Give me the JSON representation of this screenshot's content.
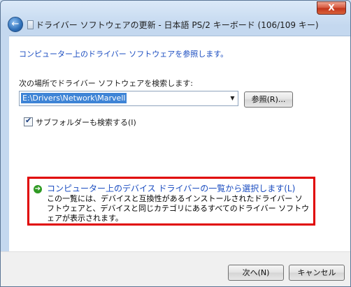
{
  "window": {
    "title": "ドライバー ソフトウェアの更新 - 日本語 PS/2 キーボード (106/109 キー)",
    "close_glyph": "X",
    "back_glyph": "←"
  },
  "main": {
    "heading": "コンピューター上のドライバー ソフトウェアを参照します。",
    "search_label": "次の場所でドライバー ソフトウェアを検索します:",
    "path_value": "E:\\Drivers\\Network\\Marvell",
    "dropdown_arrow": "▼",
    "browse_label": "参照(R)...",
    "subfolder_label": "サブフォルダーも検索する(I)",
    "subfolder_checked": true,
    "option": {
      "title": "コンピューター上のデバイス ドライバーの一覧から選択します(L)",
      "description": "この一覧には、デバイスと互換性があるインストールされたドライバー ソフトウェアと、デバイスと同じカテゴリにあるすべてのドライバー ソフトウェアが表示されます。",
      "icon": "green-arrow-icon",
      "icon_glyph": "➔"
    }
  },
  "footer": {
    "next_label": "次へ(N)",
    "cancel_label": "キャンセル"
  },
  "colors": {
    "link_blue": "#1a4cc0",
    "highlight_red": "#e00000",
    "selection_blue": "#3e84d6"
  }
}
